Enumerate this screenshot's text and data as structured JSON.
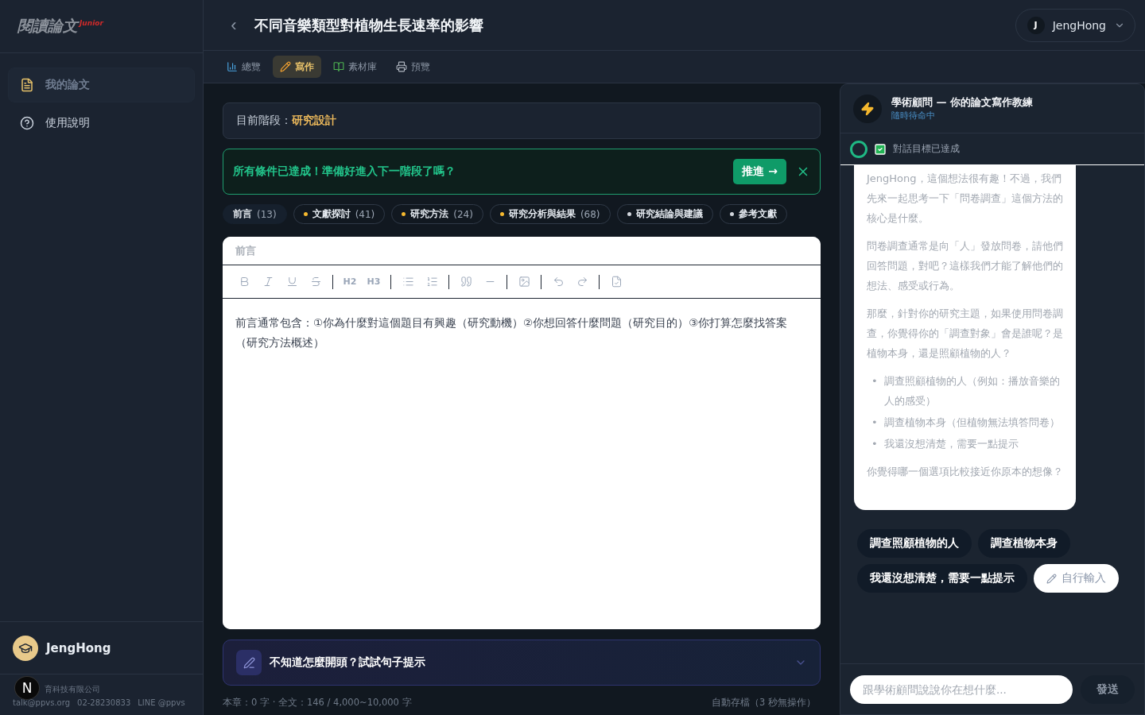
{
  "sidebar": {
    "logo": {
      "main": "閱讀論文",
      "tag": "Junior"
    },
    "items": [
      {
        "label": "我的論文",
        "selected": true
      },
      {
        "label": "使用說明",
        "selected": false
      }
    ],
    "user": {
      "name": "JengHong"
    },
    "footer": {
      "company": "育科技有限公司",
      "contact": [
        "talk@ppvs.org",
        "02-28230833",
        "LINE @ppvs"
      ]
    },
    "dev_badge": "N"
  },
  "header": {
    "back": "‹",
    "title": "不同音樂類型對植物生長速率的影響",
    "user": {
      "initial": "J",
      "name": "JengHong"
    }
  },
  "tabs": [
    {
      "label": "總覽",
      "selected": false
    },
    {
      "label": "寫作",
      "selected": true
    },
    {
      "label": "素材庫",
      "selected": false
    },
    {
      "label": "預覽",
      "selected": false
    }
  ],
  "stage": {
    "label": "目前階段：",
    "value": "研究設計"
  },
  "banner": {
    "text": "所有條件已達成！準備好進入下一階段了嗎？",
    "button": "推進 →"
  },
  "chapters": [
    {
      "label": "前言",
      "count": "(13)",
      "selected": true
    },
    {
      "label": "文獻探討",
      "count": "(41)",
      "selected": false,
      "color": "#f5b82e"
    },
    {
      "label": "研究方法",
      "count": "(24)",
      "selected": false,
      "color": "#f5b82e"
    },
    {
      "label": "研究分析與結果",
      "count": "(68)",
      "selected": false,
      "color": "#f5b82e"
    },
    {
      "label": "研究結論與建議",
      "selected": false,
      "color": "#d1d5db"
    },
    {
      "label": "參考文獻",
      "selected": false,
      "color": "#d1d5db"
    }
  ],
  "editor": {
    "title_placeholder": "前言",
    "heading_buttons": [
      "H2",
      "H3"
    ],
    "body_placeholder": "前言通常包含：①你為什麼對這個題目有興趣（研究動機）②你想回答什麼問題（研究目的）③你打算怎麼找答案（研究方法概述）"
  },
  "hint": {
    "text": "不知道怎麼開頭？試試句子提示",
    "expanded": false
  },
  "status": {
    "counts": "本章：0 字 · 全文：146 / 4,000~10,000 字",
    "autosave": "自動存檔（3 秒無操作）"
  },
  "chat": {
    "title": "學術顧問 — 你的論文寫作教練",
    "subtitle": "隨時待命中",
    "goal": "對話目標已達成",
    "goal_done": true,
    "message": [
      {
        "kind": "p",
        "text": "JengHong，這個想法很有趣！不過，我們先來一起思考一下「問卷調查」這個方法的核心是什麼。"
      },
      {
        "kind": "p",
        "text": "問卷調查通常是向「人」發放問卷，請他們回答問題，對吧？這樣我們才能了解他們的想法、感受或行為。"
      },
      {
        "kind": "p",
        "text": "那麼，針對你的研究主題，如果使用問卷調查，你覺得你的「調查對象」會是誰呢？是植物本身，還是照顧植物的人？"
      },
      {
        "kind": "li",
        "marker": "•",
        "text": "調查照顧植物的人（例如：播放音樂的人的感受）"
      },
      {
        "kind": "li",
        "marker": "•",
        "text": "調查植物本身（但植物無法填答問卷）"
      },
      {
        "kind": "li",
        "marker": "•",
        "text": "我還沒想清楚，需要一點提示"
      },
      {
        "kind": "p",
        "text": "你覺得哪一個選項比較接近你原本的想像？"
      }
    ],
    "replies": [
      {
        "label": "調查照顧植物的人",
        "kind": "option"
      },
      {
        "label": "調查植物本身",
        "kind": "option"
      },
      {
        "label": "我還沒想清楚，需要一點提示",
        "kind": "option"
      },
      {
        "label": "自行輸入",
        "kind": "custom"
      }
    ],
    "input_placeholder": "跟學術顧問說說你在想什麼...",
    "send": "發送"
  }
}
